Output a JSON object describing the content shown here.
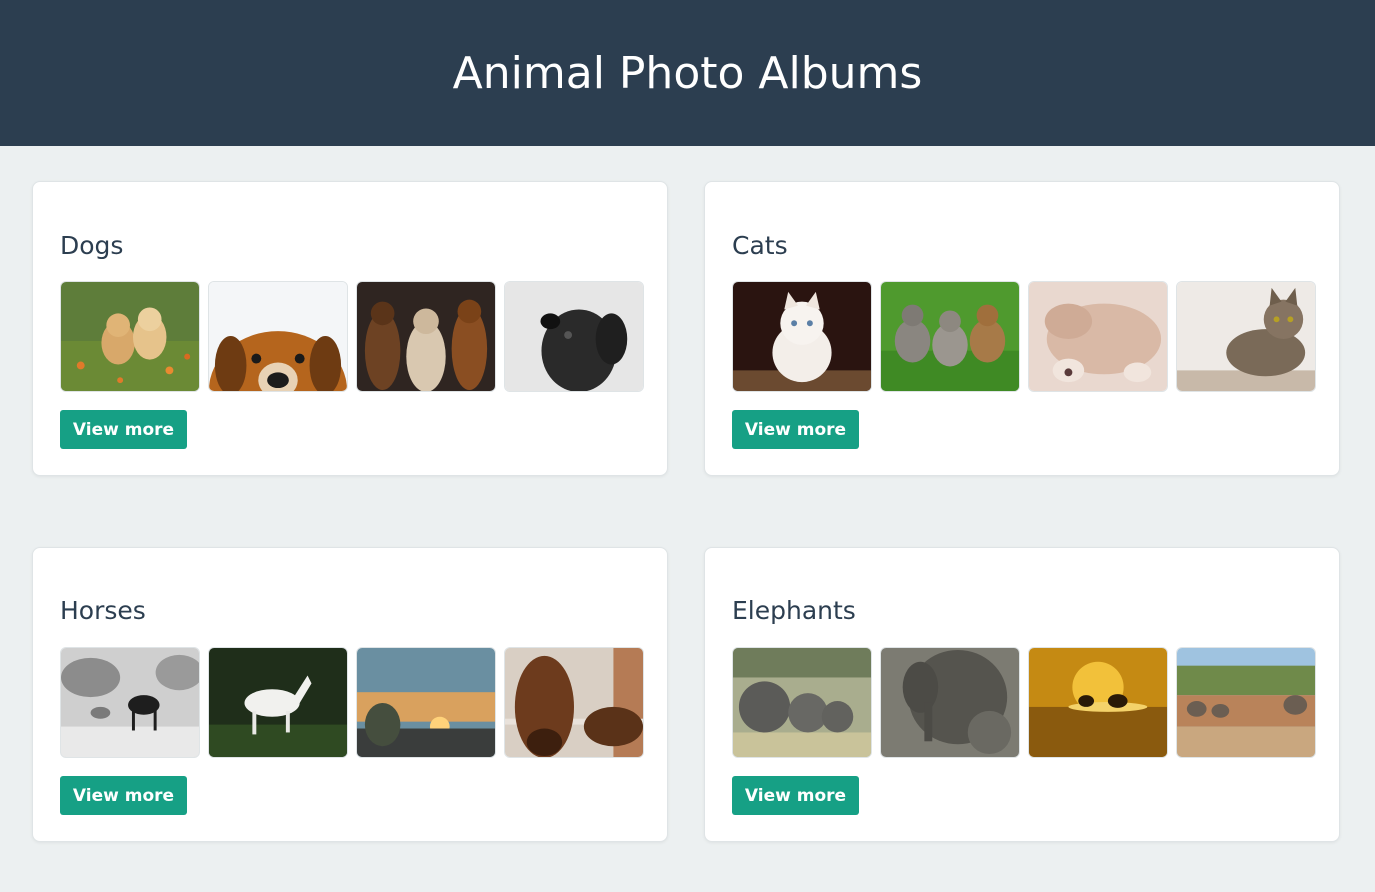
{
  "header": {
    "title": "Animal Photo Albums"
  },
  "albums": [
    {
      "title": "Dogs",
      "button_label": "View more",
      "photos": [
        "golden-puppies-photo",
        "peeking-dog-photo",
        "three-dogs-photo",
        "black-pug-photo"
      ]
    },
    {
      "title": "Cats",
      "button_label": "View more",
      "photos": [
        "white-kitten-photo",
        "kittens-on-grass-photo",
        "sleeping-kitten-photo",
        "tabby-cat-photo"
      ]
    },
    {
      "title": "Horses",
      "button_label": "View more",
      "photos": [
        "horses-in-fog-photo",
        "white-horse-running-photo",
        "sunset-landscape-photo",
        "brown-horse-face-photo"
      ]
    },
    {
      "title": "Elephants",
      "button_label": "View more",
      "photos": [
        "elephant-herd-photo",
        "elephant-and-calf-photo",
        "elephants-at-sunset-photo",
        "elephants-by-water-photo"
      ]
    }
  ],
  "colors": {
    "header_bg": "#2c3e50",
    "page_bg": "#ecf0f1",
    "button_bg": "#16a085",
    "text": "#2c3e50"
  }
}
